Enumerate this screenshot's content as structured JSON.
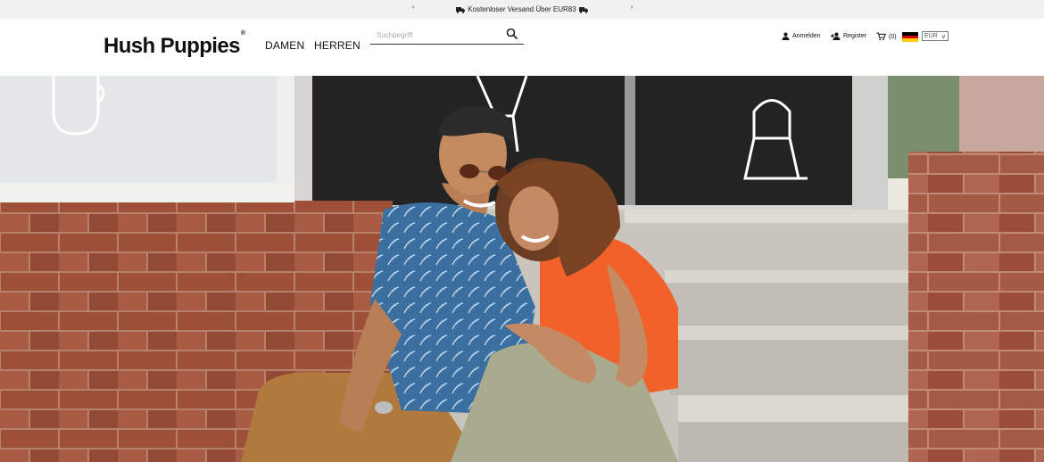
{
  "promo": {
    "message": "Kostenloser Versand Über EUR83",
    "prev_arrow": "‹",
    "next_arrow": "›"
  },
  "header": {
    "logo": "Hush Puppies",
    "logo_mark": "®",
    "nav": [
      {
        "label": "DAMEN"
      },
      {
        "label": "HERREN"
      }
    ],
    "search": {
      "placeholder": "Suchbegriff",
      "value": ""
    },
    "login_label": "Anmelden",
    "register_label": "Register",
    "cart_count": "(0)",
    "language": "de-flag-icon",
    "currency": "EUR",
    "currency_caret": "∨"
  },
  "colors": {
    "promo_bg": "#f1f1f1",
    "header_bg": "#ffffff",
    "text": "#111111",
    "brick": "#a1573e",
    "shirt_orange": "#f2612a",
    "shirt_blue": "#3c6f9e"
  },
  "icons": [
    "truck-icon",
    "search-icon",
    "user-icon",
    "user-plus-icon",
    "cart-icon",
    "germany-flag-icon",
    "chevron-down-icon"
  ]
}
